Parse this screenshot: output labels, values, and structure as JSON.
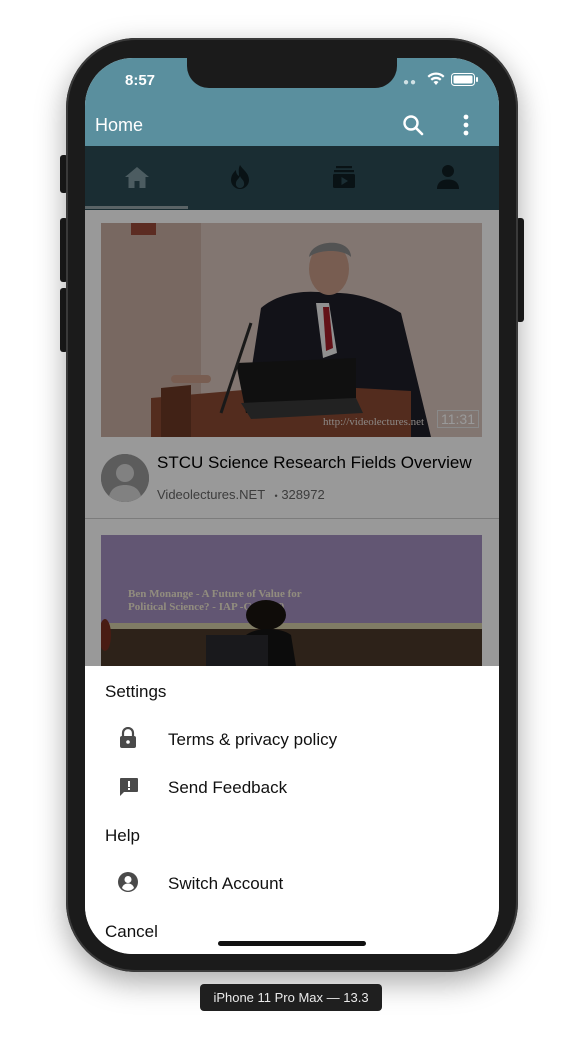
{
  "status_bar": {
    "time": "8:57"
  },
  "app_bar": {
    "title": "Home"
  },
  "tabs": [
    {
      "name": "home",
      "icon": "home-icon",
      "selected": true
    },
    {
      "name": "trending",
      "icon": "fire-icon",
      "selected": false
    },
    {
      "name": "subscriptions",
      "icon": "subscriptions-icon",
      "selected": false
    },
    {
      "name": "account",
      "icon": "person-icon",
      "selected": false
    }
  ],
  "feed": {
    "items": [
      {
        "title": "STCU Science Research Fields Overview",
        "channel": "Videolectures.NET",
        "views": "328972",
        "separator": "•",
        "duration": "11:31",
        "watermark": "http://videolectures.net"
      },
      {
        "slide_text_line1": "Ben Monange - A Future of Value for",
        "slide_text_line2": "Political Science? - IAP      -GA 2009"
      }
    ]
  },
  "action_sheet": {
    "settings_header": "Settings",
    "terms_label": "Terms & privacy policy",
    "feedback_label": "Send Feedback",
    "help_label": "Help",
    "switch_account_label": "Switch Account",
    "cancel_label": "Cancel"
  },
  "device_label": "iPhone 11 Pro Max — 13.3",
  "colors": {
    "app_bar": "#5a8f9e",
    "tab_bar": "#2c4c55"
  }
}
